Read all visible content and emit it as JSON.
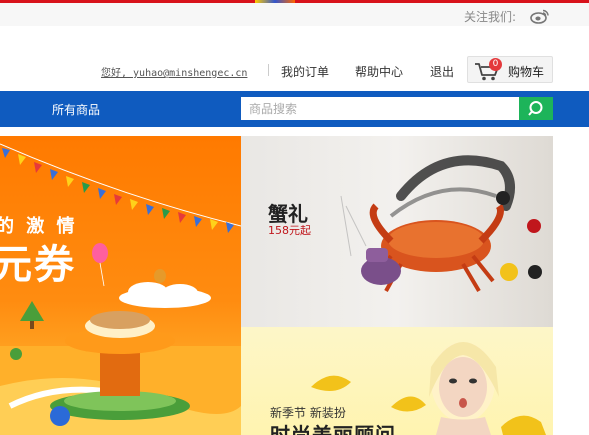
{
  "topbar": {
    "follow_label": "关注我们:",
    "weibo_icon": "weibo-icon"
  },
  "header": {
    "greeting": "您好, yuhao@minshengec.cn",
    "links": [
      "我的订单",
      "帮助中心",
      "退出"
    ],
    "cart": {
      "label": "购物车",
      "count": "0",
      "icon": "cart-icon"
    }
  },
  "navbar": {
    "all_products": "所有商品",
    "search_placeholder": "商品搜索",
    "search_icon": "search-icon"
  },
  "banners": {
    "left": {
      "line1": "的 激 情",
      "line2": "元券"
    },
    "crab": {
      "title": "蟹礼",
      "price": "158元起"
    },
    "season": {
      "line1": "新季节  新装扮",
      "line2": "时尚美丽顾问"
    }
  },
  "colors": {
    "brand_blue": "#0f5bbf",
    "search_green": "#1db45a",
    "badge_red": "#e4393c",
    "top_red": "#d8121b"
  }
}
